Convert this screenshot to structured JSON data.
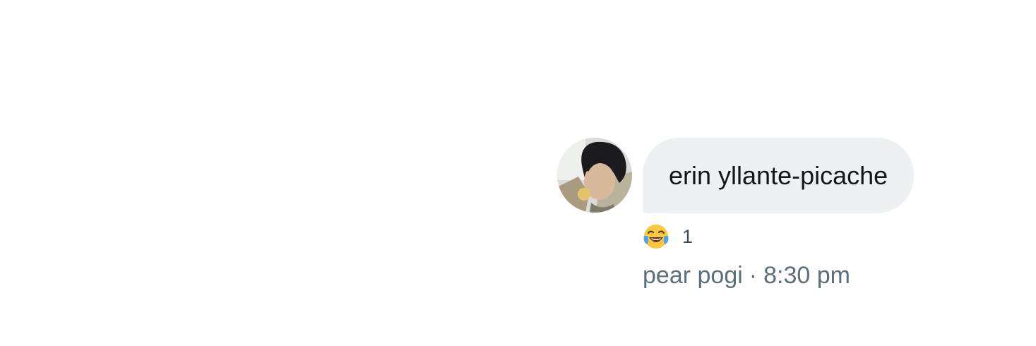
{
  "message": {
    "text": "erin yllante-picache",
    "reaction": {
      "emoji": "😂",
      "icon": "face-with-tears-of-joy-icon",
      "count": "1"
    },
    "sender": "pear pogi",
    "separator": "·",
    "time": "8:30 pm"
  },
  "colors": {
    "bubble_background": "#eef1f2",
    "message_text": "#14171a",
    "meta_text": "#5b6f79"
  }
}
